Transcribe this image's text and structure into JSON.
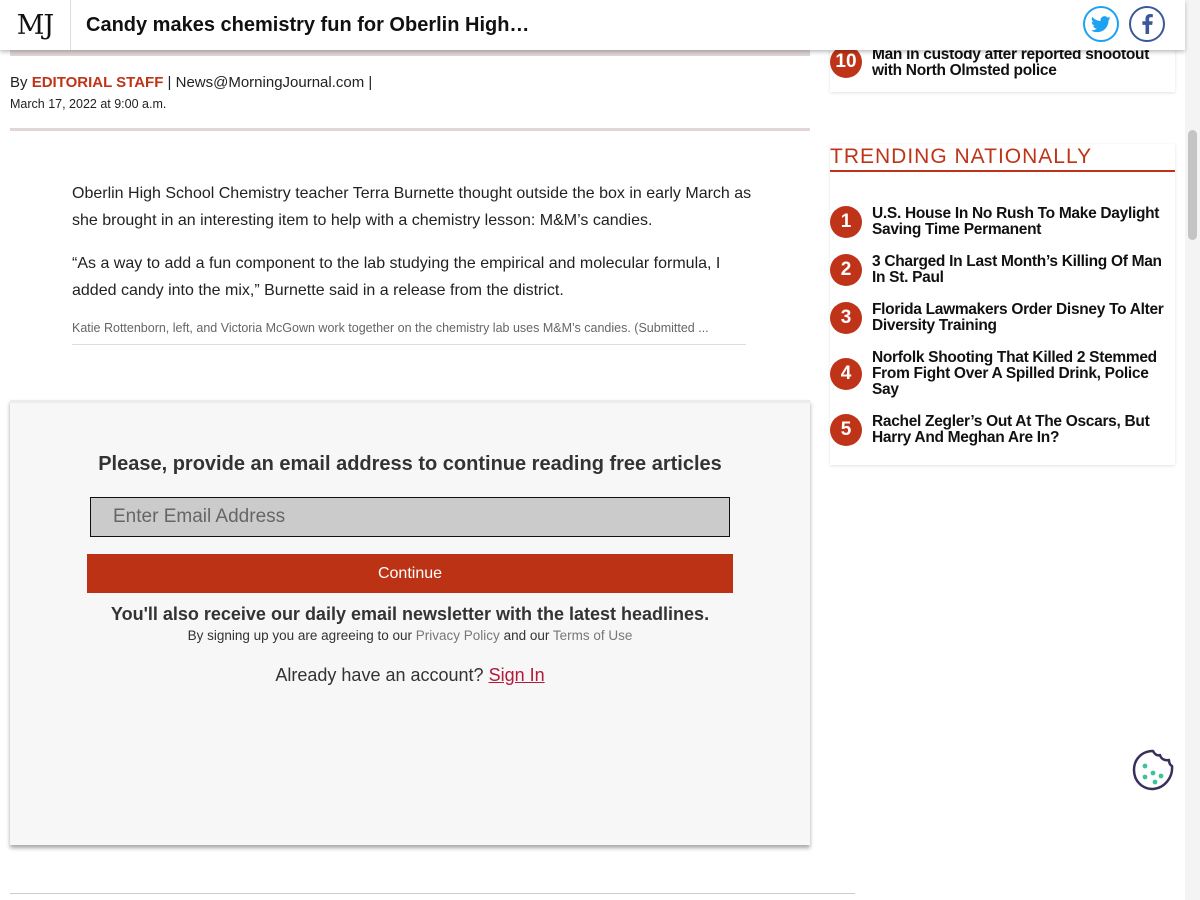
{
  "header": {
    "logo": "MJ",
    "headline": "Candy makes chemistry fun for Oberlin High…",
    "twitter_icon": "twitter-icon",
    "facebook_icon": "facebook-icon"
  },
  "article": {
    "by_prefix": "By",
    "author": "EDITORIAL STAFF",
    "separator1": "|",
    "email": "News@MorningJournal.com",
    "separator2": "|",
    "date": "March 17, 2022 at 9:00 a.m.",
    "paragraphs": [
      "Oberlin High School Chemistry teacher Terra Burnette thought outside the box in early March as she brought in an interesting item to help with a chemistry lesson: M&M’s candies.",
      "“As a way to add a fun component to the lab studying the empirical and molecular formula, I added candy into the mix,” Burnette said in a release from the district."
    ],
    "caption": "Katie Rottenborn, left, and Victoria McGown work together on the chemistry lab uses M&M’s candies. (Submitted ..."
  },
  "paywall": {
    "title": "Please, provide an email address to continue reading free articles",
    "email_placeholder": "Enter Email Address",
    "continue_label": "Continue",
    "newsletter_note": "You'll also receive our daily email newsletter with the latest headlines.",
    "terms_prefix": "By signing up you are agreeing to our",
    "privacy_link": "Privacy Policy",
    "terms_middle": "and our",
    "terms_link": "Terms of Use",
    "account_prompt": "Already have an account?",
    "sign_in": "Sign In"
  },
  "sidebar": {
    "local_item": {
      "rank": "10",
      "title": "Man in custody after reported shootout with North Olmsted police"
    },
    "trending_title": "TRENDING NATIONALLY",
    "trending": [
      {
        "rank": "1",
        "title": "U.S. House In No Rush To Make Daylight Saving Time Permanent"
      },
      {
        "rank": "2",
        "title": "3 Charged In Last Month’s Killing Of Man In St. Paul"
      },
      {
        "rank": "3",
        "title": "Florida Lawmakers Order Disney To Alter Diversity Training"
      },
      {
        "rank": "4",
        "title": "Norfolk Shooting That Killed 2 Stemmed From Fight Over A Spilled Drink, Police Say"
      },
      {
        "rank": "5",
        "title": "Rachel Zegler’s Out At The Oscars, But Harry And Meghan Are In?"
      }
    ]
  },
  "cookie": {
    "icon": "cookie-icon"
  },
  "colors": {
    "accent": "#bf3418",
    "button": "#bc3215",
    "twitter": "#1da1f2",
    "facebook": "#3b5998",
    "sign_in_link": "#b11a3a",
    "cookie_outline": "#3c2e5c",
    "cookie_dots": "#3fc29a"
  }
}
